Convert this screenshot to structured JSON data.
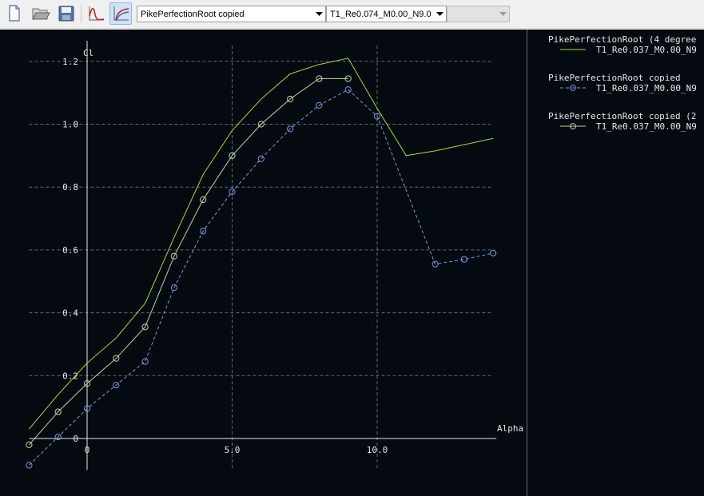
{
  "toolbar": {
    "airfoil_select": {
      "value": "PikePerfectionRoot copied"
    },
    "polar_select": {
      "value": "T1_Re0.074_M0.00_N9.0"
    },
    "opoint_select": {
      "value": ""
    }
  },
  "colors": {
    "background": "#050a10",
    "axis": "#e6e6e6",
    "grid": "#8a8a8a",
    "series_green": "#9bdf3a",
    "series_circles": "#bcd6a0",
    "series_blue": "#6f9fe0"
  },
  "chart_data": {
    "type": "line",
    "xlabel": "Alpha",
    "ylabel": "Cl",
    "xlim": [
      -2,
      14
    ],
    "ylim": [
      -0.1,
      1.25
    ],
    "xticks": [
      {
        "v": 0,
        "label": "0"
      },
      {
        "v": 5,
        "label": "5.0"
      },
      {
        "v": 10,
        "label": "10.0"
      }
    ],
    "yticks": [
      {
        "v": 0,
        "label": "0"
      },
      {
        "v": 0.2,
        "label": "0.2"
      },
      {
        "v": 0.4,
        "label": "0.4"
      },
      {
        "v": 0.6,
        "label": "0.6"
      },
      {
        "v": 0.8,
        "label": "0.8"
      },
      {
        "v": 1.0,
        "label": "1.0"
      },
      {
        "v": 1.2,
        "label": "1.2"
      }
    ],
    "grid": true,
    "series": [
      {
        "name": "T1_Re0.037_M0.00_N9",
        "airfoil": "PikePerfectionRoot (4 degree",
        "style": "solid",
        "marker": "none",
        "color": "#9bdf3a",
        "x": [
          -2,
          -1,
          0,
          1,
          2,
          3,
          4,
          5,
          6,
          7,
          8,
          9,
          10,
          11,
          12,
          13,
          14
        ],
        "y": [
          0.03,
          0.14,
          0.24,
          0.32,
          0.43,
          0.64,
          0.84,
          0.98,
          1.08,
          1.16,
          1.19,
          1.21,
          1.05,
          0.9,
          0.915,
          0.935,
          0.955
        ]
      },
      {
        "name": "T1_Re0.037_M0.00_N9",
        "airfoil": "PikePerfectionRoot copied",
        "style": "dashed",
        "marker": "circle",
        "color": "#6f9fe0",
        "x": [
          -2,
          -1,
          0,
          1,
          2,
          3,
          4,
          5,
          6,
          7,
          8,
          9,
          10,
          12,
          13,
          14
        ],
        "y": [
          -0.085,
          0.005,
          0.095,
          0.17,
          0.245,
          0.48,
          0.66,
          0.785,
          0.89,
          0.985,
          1.06,
          1.11,
          1.025,
          0.555,
          0.57,
          0.59
        ]
      },
      {
        "name": "T1_Re0.037_M0.00_N9",
        "airfoil": "PikePerfectionRoot copied (2",
        "style": "solid",
        "marker": "circle",
        "color": "#bcd6a0",
        "x": [
          -2,
          -1,
          0,
          1,
          2,
          3,
          4,
          5,
          6,
          7,
          8,
          9
        ],
        "y": [
          -0.02,
          0.085,
          0.175,
          0.255,
          0.355,
          0.58,
          0.76,
          0.9,
          1.0,
          1.08,
          1.145,
          1.145
        ]
      }
    ]
  }
}
